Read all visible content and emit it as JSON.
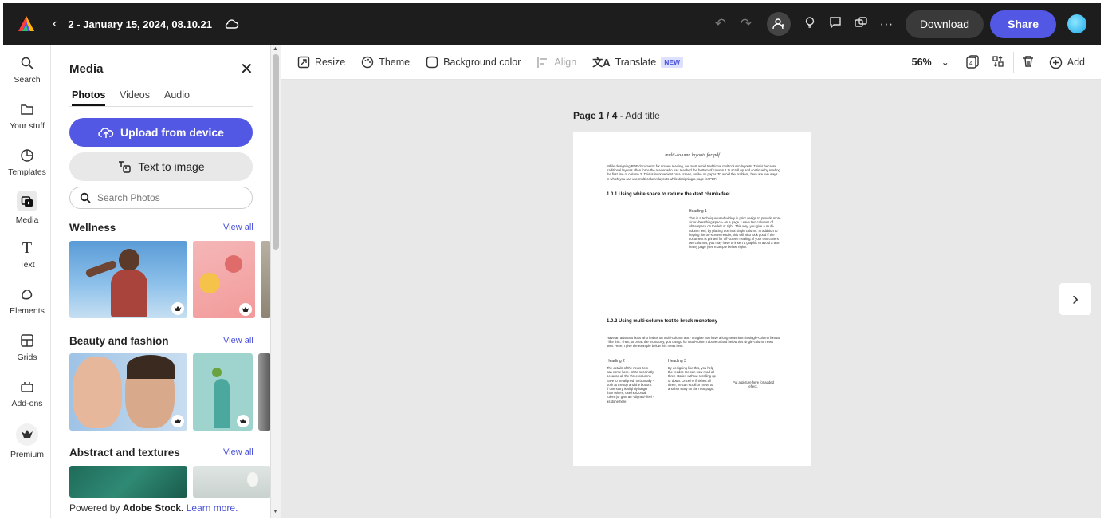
{
  "topbar": {
    "doc_title": "2 - January 15, 2024, 08.10.21",
    "download_label": "Download",
    "share_label": "Share"
  },
  "rail": {
    "items": [
      {
        "label": "Search",
        "icon": "search-icon"
      },
      {
        "label": "Your stuff",
        "icon": "folder-icon"
      },
      {
        "label": "Templates",
        "icon": "templates-icon"
      },
      {
        "label": "Media",
        "icon": "media-icon"
      },
      {
        "label": "Text",
        "icon": "text-icon"
      },
      {
        "label": "Elements",
        "icon": "elements-icon"
      },
      {
        "label": "Grids",
        "icon": "grids-icon"
      },
      {
        "label": "Add-ons",
        "icon": "addons-icon"
      },
      {
        "label": "Premium",
        "icon": "premium-icon"
      }
    ]
  },
  "panel": {
    "title": "Media",
    "tabs": [
      "Photos",
      "Videos",
      "Audio"
    ],
    "upload_label": "Upload from device",
    "text_to_image_label": "Text to image",
    "search_placeholder": "Search Photos",
    "sections": [
      {
        "title": "Wellness",
        "view_all": "View all"
      },
      {
        "title": "Beauty and fashion",
        "view_all": "View all"
      },
      {
        "title": "Abstract and textures",
        "view_all": "View all"
      }
    ],
    "footer_prefix": "Powered by ",
    "footer_brand": "Adobe Stock.",
    "footer_link": "Learn more."
  },
  "toolbar": {
    "resize": "Resize",
    "theme": "Theme",
    "background_color": "Background color",
    "align": "Align",
    "translate": "Translate",
    "new_badge": "NEW",
    "zoom": "56%",
    "add": "Add"
  },
  "canvas": {
    "page_label_bold": "Page 1 / 4",
    "page_label_rest": " - Add title"
  },
  "document": {
    "title": "multi-column layouts for pdf",
    "intro": "While designing PDF documents for screen reading, we must avoid traditional multicolumn layouts. This is because traditional layouts often force the reader who has reached the bottom of column 1 to scroll up and continue by reading the first line of column 2. This is inconvenient on a screen, unlike on paper. To avoid the problem, here are two ways in which you can use multi-column layouts while designing a page for PDF.",
    "h1": "1.0.1 Using white space to reduce the •text chunk• feel",
    "heading1": "Heading 1",
    "heading1_text": "This is a technique used widely in print design to provide more air or -breathing space- on a page. Leave two columns of white space on the left or right. This way, you give a multi-column feel, by placing text in a single column. In addition to helping the on-screen reader, this will also look good if the document is printed for off-screen reading. If your text covers two columns, you may have to insert a graphic to avoid a text-heavy page (see example below, right).",
    "h2": "1.0.2 Using multi-column text to break monotony",
    "body2": "Have an adamant boss who insists on multi-column text? Imagine you have a long news item in single-column format - like this. Then, to break the monotony, you can go for multi-column above or/and below this single-column news item. Here, I give the example below this news item.",
    "heading2": "Heading 2",
    "heading2_text": "The details of the news item can come here. Write succinctly because all the three columns have to be aligned horizontally - both at the top and the bottom. If one story is slightly longer than others, use horizontal rulers (or give an -aligned- feel - as done here.",
    "heading3": "Heading 3",
    "heading3_text": "By designing like this, you help the reader. He can now read all three stories without scrolling up or down. Once he finishes all three, he can scroll or move to another story on the next page.",
    "picture_note": "Put a picture here for added effect."
  }
}
